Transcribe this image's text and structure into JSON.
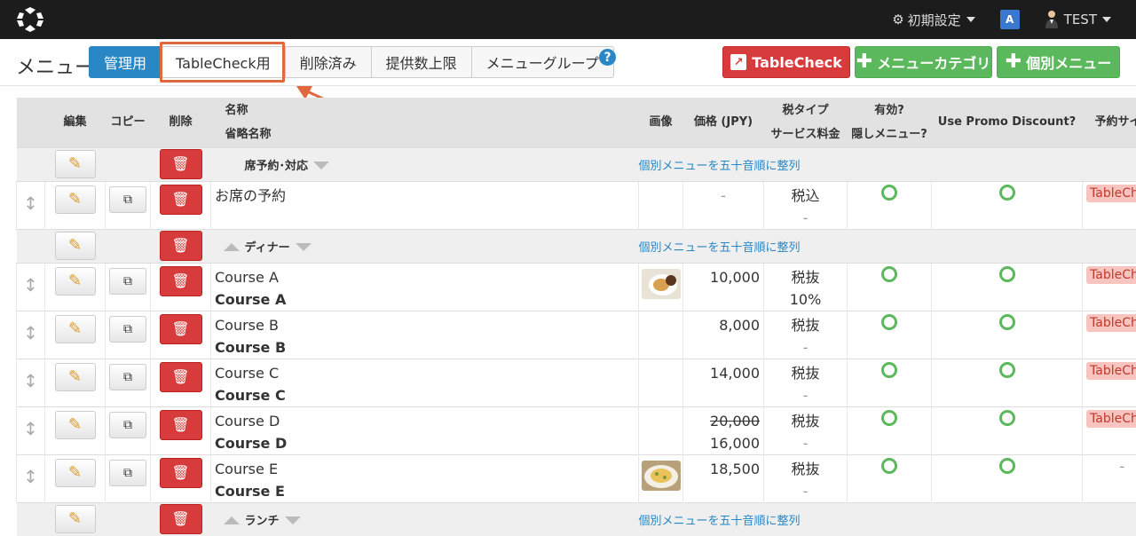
{
  "topbar": {
    "settings_label": "初期設定",
    "user_label": "TEST",
    "translate_label": "A"
  },
  "page": {
    "title": "メニュー"
  },
  "tabs": [
    {
      "label": "管理用",
      "active": true
    },
    {
      "label": "TableCheck用"
    },
    {
      "label": "削除済み"
    },
    {
      "label": "提供数上限"
    },
    {
      "label": "メニューグループ"
    }
  ],
  "help_label": "?",
  "buttons": {
    "tablecheck": "TableCheck",
    "add_category": "メニューカテゴリ",
    "add_item": "個別メニュー"
  },
  "table": {
    "headers": {
      "edit": "編集",
      "copy": "コピー",
      "delete": "削除",
      "name": "名称",
      "short_name": "省略名称",
      "image": "画像",
      "price": "価格 (JPY)",
      "tax_type": "税タイプ",
      "service_fee": "サービス料金",
      "active": "有効?",
      "hidden": "隠しメニュー?",
      "promo": "Use Promo Discount?",
      "reservation": "予約サイ"
    },
    "sort_link": "個別メニューを五十音順に整列",
    "groups": [
      {
        "name": "席予約･対応"
      },
      {
        "name": "ディナー"
      },
      {
        "name": "ランチ"
      }
    ],
    "rows": [
      {
        "name": "お席の予約",
        "short": "",
        "price": "-",
        "price_old": "",
        "tax": "税込",
        "fee": "-",
        "badge": "TableCheck",
        "image": ""
      },
      {
        "name": "Course A",
        "short": "Course A",
        "price": "10,000",
        "price_old": "",
        "tax": "税抜",
        "fee": "10%",
        "badge": "TableCheck",
        "image": "food1"
      },
      {
        "name": "Course B",
        "short": "Course B",
        "price": "8,000",
        "price_old": "",
        "tax": "税抜",
        "fee": "-",
        "badge": "TableCheck",
        "image": ""
      },
      {
        "name": "Course C",
        "short": "Course C",
        "price": "14,000",
        "price_old": "",
        "tax": "税抜",
        "fee": "-",
        "badge": "TableCheck",
        "image": ""
      },
      {
        "name": "Course D",
        "short": "Course D",
        "price": "16,000",
        "price_old": "20,000",
        "tax": "税抜",
        "fee": "-",
        "badge": "TableCheck",
        "image": ""
      },
      {
        "name": "Course E",
        "short": "Course E",
        "price": "18,500",
        "price_old": "",
        "tax": "税抜",
        "fee": "-",
        "badge": "-",
        "image": "food2"
      }
    ]
  }
}
